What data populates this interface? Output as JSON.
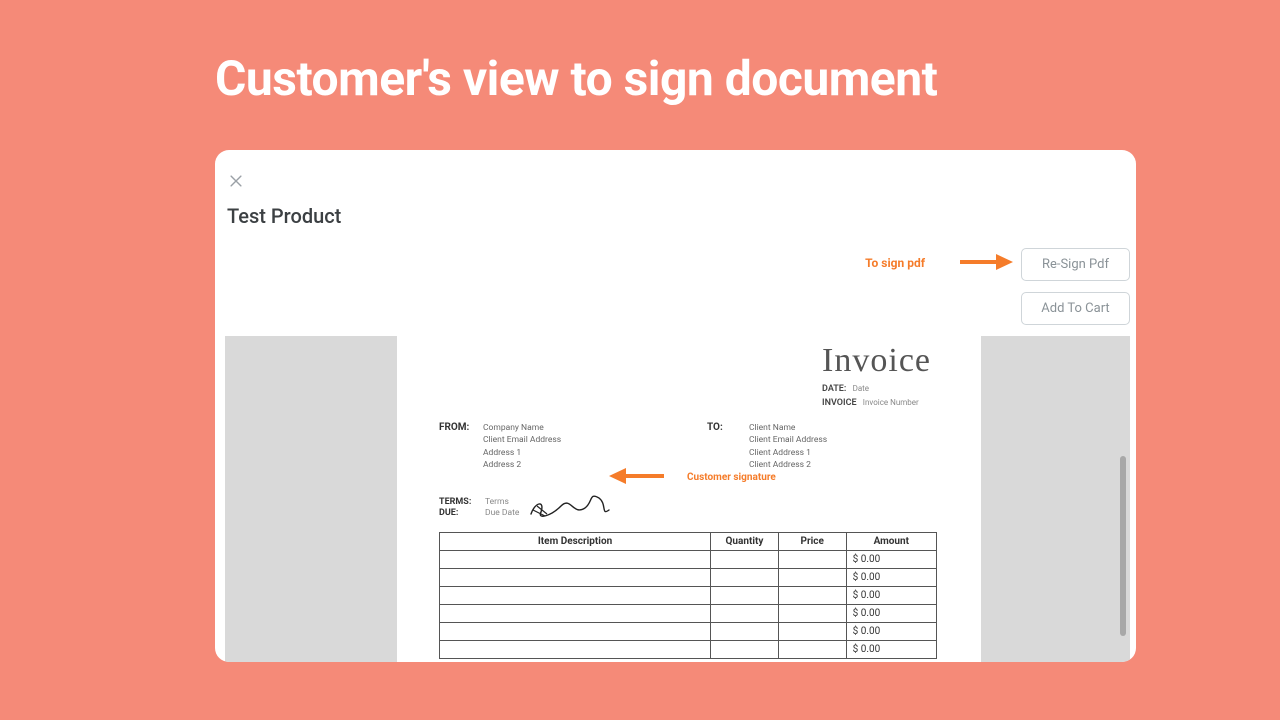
{
  "page_title": "Customer's view to sign document",
  "modal": {
    "product_title": "Test Product",
    "to_sign_hint": "To sign pdf",
    "resign_label": "Re-Sign Pdf",
    "add_label": "Add To Cart"
  },
  "annotations": {
    "signature_hint": "Customer signature"
  },
  "invoice": {
    "title": "Invoice",
    "date_label": "DATE:",
    "date_value": "Date",
    "invno_label": "INVOICE",
    "invno_value": "Invoice Number",
    "from_label": "FROM:",
    "to_label": "TO:",
    "from": {
      "company": "Company Name",
      "email": "Client Email Address",
      "addr1": "Address 1",
      "addr2": "Address 2"
    },
    "to": {
      "name": "Client Name",
      "email": "Client Email Address",
      "addr1": "Client Address 1",
      "addr2": "Client Address 2"
    },
    "terms_label": "TERMS:",
    "terms_value": "Terms",
    "due_label": "DUE:",
    "due_value": "Due Date",
    "table": {
      "headers": {
        "desc": "Item Description",
        "qty": "Quantity",
        "price": "Price",
        "amount": "Amount"
      },
      "amounts": [
        "$ 0.00",
        "$ 0.00",
        "$ 0.00",
        "$ 0.00",
        "$ 0.00",
        "$ 0.00"
      ]
    }
  },
  "colors": {
    "accent_orange": "#f57c2a",
    "background_coral": "#f58a78"
  }
}
